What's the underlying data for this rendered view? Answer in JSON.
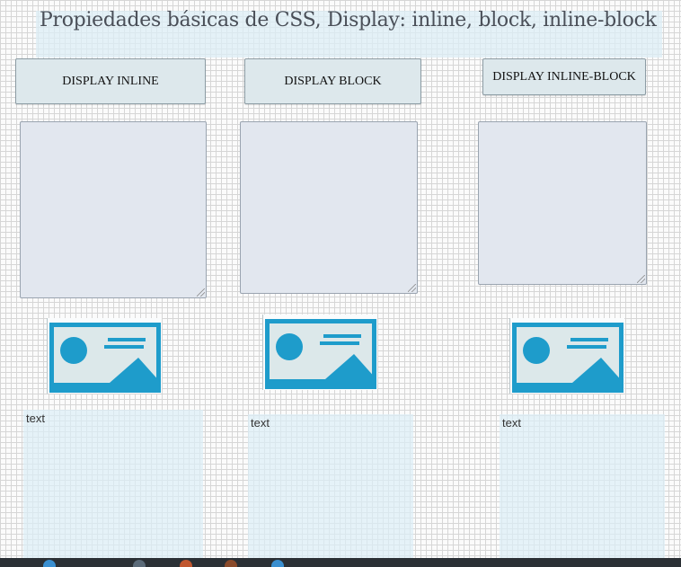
{
  "page": {
    "title": "Propiedades básicas de CSS, Display: inline, block, inline-block"
  },
  "buttons": {
    "inline": "DISPLAY INLINE",
    "block": "DISPLAY BLOCK",
    "inline_block": "DISPLAY INLINE-BLOCK"
  },
  "text_boxes": {
    "inline": "text",
    "block": "text",
    "inline_block": "text"
  },
  "colors": {
    "image_blue": "#1e9ccb",
    "image_bg": "#dce8ea",
    "panel_tint": "#dceef6",
    "button_bg": "#dde8ec",
    "textarea_bg": "#e2e7ef",
    "taskbar": "#2b3035"
  },
  "icons": [
    "image-placeholder-icon",
    "resize-grip-icon"
  ]
}
